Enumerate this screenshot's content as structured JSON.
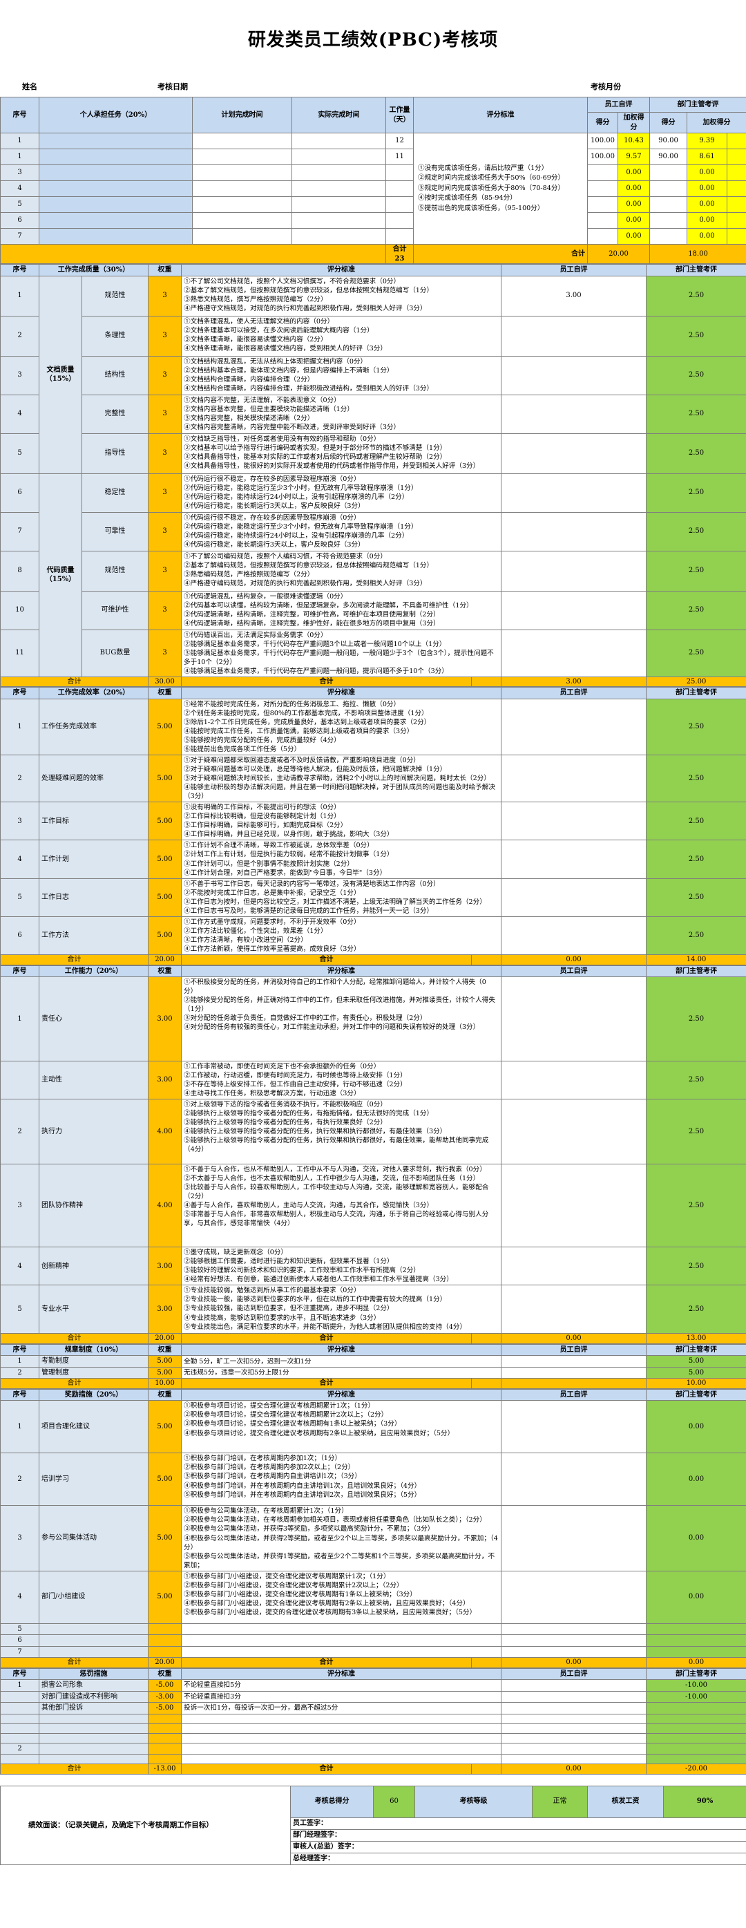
{
  "title": "研发类员工绩效(PBC)考核项",
  "info": {
    "name": "姓名",
    "date": "考核日期",
    "month": "考核月份"
  },
  "tasks": {
    "h": {
      "no": "序号",
      "task": "个人承担任务（20%）",
      "plan": "计划完成时间",
      "actual": "实际完成时间",
      "days": "工作量（天）",
      "std": "评分标准",
      "self": "员工自评",
      "mgr": "部门主管考评",
      "score": "得分",
      "wscore": "加权得分"
    },
    "std": "①没有完成该项任务，请后比较严重（1分）\n②规定时间内完成该项任务大于50%（60-69分）\n③规定时间内完成该项任务大于80%（70-84分）\n④按时完成该项任务（85-94分）\n⑤提前出色的完成该项任务，（95-100分）",
    "rows": [
      {
        "no": "1",
        "days": "12",
        "ss": "100.00",
        "sw": "10.43",
        "ms": "90.00",
        "mw": "9.39"
      },
      {
        "no": "1",
        "days": "11",
        "ss": "100.00",
        "sw": "9.57",
        "ms": "90.00",
        "mw": "8.61"
      },
      {
        "no": "3",
        "days": "",
        "ss": "",
        "sw": "0.00",
        "ms": "",
        "mw": "0.00"
      },
      {
        "no": "4",
        "days": "",
        "ss": "",
        "sw": "0.00",
        "ms": "",
        "mw": "0.00"
      },
      {
        "no": "5",
        "days": "",
        "ss": "",
        "sw": "0.00",
        "ms": "",
        "mw": "0.00"
      },
      {
        "no": "6",
        "days": "",
        "ss": "",
        "sw": "0.00",
        "ms": "",
        "mw": "0.00"
      },
      {
        "no": "7",
        "days": "",
        "ss": "",
        "sw": "0.00",
        "ms": "",
        "mw": "0.00"
      }
    ],
    "sum": {
      "label": "合计",
      "days": "23",
      "label2": "合计",
      "self": "20.00",
      "mgr": "18.00"
    }
  },
  "quality": {
    "h": {
      "no": "序号",
      "title": "工作完成质量（30%）",
      "w": "权重",
      "std": "评分标准",
      "self": "员工自评",
      "mgr": "部门主管考评"
    },
    "groups": {
      "doc": "文档质量（15%）",
      "code": "代码质量（15%）"
    },
    "rows": [
      {
        "no": "1",
        "item": "规范性",
        "w": "3",
        "self": "3.00",
        "mgr": "2.50",
        "std": "①不了解公司文档规范，按照个人文档习惯撰写，不符合规范要求（0分）\n②基本了解文档规范，但按照规范撰写的意识较淡，但总体按照文档规范编写（1分）\n③熟悉文档规范，撰写严格按照规范编写（2分）\n④严格遵守文档规范，对规范的执行和完善起到积极作用，受到相关人好评（3分）"
      },
      {
        "no": "2",
        "item": "条理性",
        "w": "3",
        "self": "",
        "mgr": "2.50",
        "std": "①文档条理混乱，使人无法理解文档的内容（0分）\n②文档条理基本可以接受，在多次阅读后能理解大概内容（1分）\n③文档条理清晰，能很容易读懂文档内容（2分）\n④文档条理清晰，能很容易读懂文档内容，受到相关人的好评（3分）"
      },
      {
        "no": "3",
        "item": "结构性",
        "w": "3",
        "self": "",
        "mgr": "2.50",
        "std": "①文档结构混乱混乱，无法从结构上体现把握文档内容（0分）\n②文档结构基本合理，能体现文档内容，但是内容编排上不清晰（1分）\n③文档结构合理清晰，内容编排合理（2分）\n④文档结构合理清晰，内容编排合理，并能积极改进结构，受到相关人的好评（3分）"
      },
      {
        "no": "4",
        "item": "完整性",
        "w": "3",
        "self": "",
        "mgr": "2.50",
        "std": "①文档内容不完整，无法理解，不能表现意义（0分）\n②文档内容基本完整，但是主要模块功能描述清晰（1分）\n③文档内容完整，相关模块描述清晰（2分）\n④文档内容完整清晰，内容完整中能不断改进，受到评审受到好评（3分）"
      },
      {
        "no": "5",
        "item": "指导性",
        "w": "3",
        "self": "",
        "mgr": "2.50",
        "std": "①文档缺乏指导性，对任务或者使用没有有效的指导和帮助（0分）\n②文档基本可以给予指导行进行编码或者实现，但是对于部分环节的描述不够清楚（1分）\n③文档具备指导性，能基本对实际的工作或者对后续的代码或者理解产生较好帮助（2分）\n④文档具备指导性，能很好的对实际开发或者使用的代码或者作指导作用，并受到相关人好评（3分）"
      },
      {
        "no": "6",
        "item": "稳定性",
        "w": "3",
        "self": "",
        "mgr": "2.50",
        "std": "①代码运行很不稳定，存在较多的因素导致程序崩溃（0分）\n②代码运行稳定，能稳定运行至少3个小时，但无故有几率导致程序崩溃（1分）\n③代码运行稳定，能持续运行24小时以上，没有引起程序崩溃的几率（2分）\n④代码运行稳定，能长期运行3天以上，客户反映良好（3分）"
      },
      {
        "no": "7",
        "item": "可靠性",
        "w": "3",
        "self": "",
        "mgr": "2.50",
        "std": "①代码运行很不稳定，存在较多的因素导致程序崩溃（0分）\n②代码运行稳定，能稳定运行至少3个小时，但无故有几率导致程序崩溃（1分）\n③代码运行稳定，能持续运行24小时以上，没有引起程序崩溃的几率（2分）\n④代码运行稳定，能长期运行3天以上，客户反映良好（3分）"
      },
      {
        "no": "8",
        "item": "规范性",
        "w": "3",
        "self": "",
        "mgr": "2.50",
        "std": "①不了解公司编码规范，按照个人编码习惯，不符合规范要求（0分）\n②基本了解编码规范，但按照规范撰写的意识较淡，但总体按照编码规范编写（1分）\n③熟悉编码规范，严格按照规范编写（2分）\n④严格遵守编码规范，对规范的执行和完善起到积极作用，受到相关人好评（3分）"
      },
      {
        "no": "10",
        "item": "可维护性",
        "w": "3",
        "self": "",
        "mgr": "2.50",
        "std": "①代码逻辑混乱，结构复杂，一般很难读懂逻辑（0分）\n②代码基本可以读懂，结构较为清晰，但是逻辑复杂，多次阅读才能理解，不具备可维护性（1分）\n③代码逻辑清晰，结构清晰，注释完整，可维护性高，可维护在本项目使用复制（2分）\n④代码逻辑清晰，结构清晰，注释完整，维护性好，能在很多地方的项目中复用（3分）"
      },
      {
        "no": "11",
        "item": "BUG数量",
        "w": "3",
        "self": "",
        "mgr": "2.50",
        "std": "①代码错误百出，无法满足实际业务需求（0分）\n②能够满足基本业务需求，千行代码存在严重问题3个以上或者一般问题10个以上（1分）\n③能够满足基本业务需求，千行代码存在严重问题一般问题，一般问题少于3个（包含3个），提示性问题不多于10个（2分）\n④能够满足基本业务需求，千行代码存在严重问题一般问题，提示问题不多于10个（3分）"
      }
    ],
    "sum": {
      "label": "合计",
      "w": "30.00",
      "label2": "合计",
      "self": "3.00",
      "mgr": "25.00"
    }
  },
  "eff": {
    "h": {
      "no": "序号",
      "title": "工作完成效率（20%）",
      "w": "权重",
      "std": "评分标准",
      "self": "员工自评",
      "mgr": "部门主管考评"
    },
    "rows": [
      {
        "no": "1",
        "item": "工作任务完成效率",
        "w": "5.00",
        "self": "",
        "mgr": "2.50",
        "std": "①经常不能按时完成任务，对所分配的任务消极怠工、拖拉、懒散（0分）\n②个别任务未能按时完成，但80%的工作都基本完成，不影响项目整体进度（1分）\n③除后1-2个工作日完成任务，完成质量良好，基本达到上级或者项目的要求（2分）\n④能按时完成工作任务，工作质量饱满，能够达到上级或者项目的要求（3分）\n⑤能够按时的完成分配的任务，完成质量较好（4分）\n⑥能提前出色完成各项工作任务（5分）"
      },
      {
        "no": "2",
        "item": "处理疑难问题的效率",
        "w": "5.00",
        "self": "",
        "mgr": "2.50",
        "std": "①对于疑难问题都采取回避态度或者不及时反馈请教，严重影响项目进度（0分）\n②对于疑难问题基本可以处理，总是等待他人解决，但能及时反馈，把问题解决掉（1分）\n③对于疑难问题解决时间较长，主动请教寻求帮助，消耗2个小时以上的时间解决问题，耗时太长（2分）\n④能够主动积极的想办法解决问题，并且在第一时间把问题解决掉，对于团队成员的问题也能及时给予解决（3分）"
      },
      {
        "no": "3",
        "item": "工作目标",
        "w": "5.00",
        "self": "",
        "mgr": "2.50",
        "std": "①没有明确的工作目标，不能提出可行的想法（0分）\n②工作目标比较明确，但是没有能够制定计划（1分）\n③工作目标明确，目标能够可行，如期完成目标（2分）\n④工作目标明确，并且已经兑现，以身作则，敢于挑战，影响大（3分）"
      },
      {
        "no": "4",
        "item": "工作计划",
        "w": "5.00",
        "self": "",
        "mgr": "2.50",
        "std": "①工作计划不合理不清晰，导致工作被延误，总体效率差（0分）\n②计划工作上有计划，但是执行能力较弱，经常不能按计划做事（1分）\n③工作计划可以，但是个别事情不能按照计划实施（2分）\n④工作计划合理，对自己严格要求，能做到\"今日事，今日毕\"（3分）"
      },
      {
        "no": "5",
        "item": "工作日志",
        "w": "5.00",
        "self": "",
        "mgr": "2.50",
        "std": "①不善于书写工作日志，每天记录的内容写一笔带过，没有清楚地表达工作内容（0分）\n②不能按时完成工作日志，总是集中补报，记录空乏（1分）\n③工作日志为按时，但是内容比较空乏，对工作描述不清楚，上级无法明确了解当天的工作任务（2分）\n④工作日志书写及时，能够清楚的记录每日完成的工作任务，并能列一天一记（3分）"
      },
      {
        "no": "6",
        "item": "工作方法",
        "w": "5.00",
        "self": "",
        "mgr": "2.50",
        "std": "①工作方式墨守成规，问题要求时，不利于开发效率（0分）\n②工作方法比较僵化，个性突出，效果差（1分）\n③工作方法清晰，有较小改进空间（2分）\n④工作方法新颖，使得工作效率显著提高，成效良好（3分）"
      }
    ],
    "sum": {
      "label": "合计",
      "w": "20.00",
      "label2": "合计",
      "self": "0.00",
      "mgr": "14.00"
    }
  },
  "ability": {
    "h": {
      "no": "序号",
      "title": "工作能力（20%）",
      "w": "权重",
      "std": "评分标准",
      "self": "员工自评",
      "mgr": "部门主管考评"
    },
    "rows": [
      {
        "no": "1",
        "item": "责任心",
        "w": "3.00",
        "self": "",
        "mgr": "2.50",
        "std": "①不积极接受分配的任务，并消极对待自己的工作和个人分配，经常推卸问题给人，并计较个人得失（0分）\n②能够接受分配的任务，并正确对待工作中的工作，但未采取任何改进措施，并对推诿责任，计较个人得失（1分）\n③对分配的任务敢于负责任，自觉做好工作中的工作，有责任心，积极处理（2分）\n④对分配的任务有较强的责任心，对工作能主动承担，并对工作中的问题和失误有较好的处理（3分）"
      },
      {
        "no": "",
        "item": "主动性",
        "w": "3.00",
        "self": "",
        "mgr": "2.50",
        "std": "①工作非常被动，即使在时间充足下也不会承担额外的任务（0分）\n②工作被动，行动迟缓，即便有时间充足力，有时候也等待上级安排（1分）\n③不存在等待上级安排工作，但工作由自己主动安排，行动不够迅速（2分）\n④主动寻找工作任务，积极思考解决方案，行动迅速（3分）"
      },
      {
        "no": "2",
        "item": "执行力",
        "w": "4.00",
        "self": "",
        "mgr": "2.50",
        "std": "①对上级领导下达的指令或者任务消极不执行，不能积极响应（0分）\n②能够执行上级领导的指令或者分配的任务，有拖拖情绪，但无法很好的完成（1分）\n③能够执行上级领导的指令或者分配的任务，有执行效果良好（2分）\n④能够执行上级领导的指令或者分配的任务，执行效果和执行都很好，有最佳效果（3分）\n⑤能够执行上级领导的指令或者分配的任务，执行效果和执行都很好，有最佳效果，能帮助其他同事完成（4分）"
      },
      {
        "no": "3",
        "item": "团队协作精神",
        "w": "4.00",
        "self": "",
        "mgr": "2.50",
        "std": "①不善于与人合作，也从不帮助别人，工作中从不与人沟通，交流，对他人要求苛刻，我行我素（0分）\n②不太善于与人合作，也不太喜欢帮助别人，工作中很少与人沟通，交流，但不影响团队任务（1分）\n③比较善于与人合作，较喜欢帮助别人，工作中较主动与人沟通，交流，能够理解和宽容别人，能够配合（2分）\n④善于与人合作，喜欢帮助别人，主动与人交流，沟通，与其合作，感觉愉快（3分）\n⑤非常善于与人合作，非常喜欢帮助别人，积极主动与人交流，沟通，乐于将自己的经验或心得与别人分享，与其合作，感觉非常愉快（4分）"
      },
      {
        "no": "4",
        "item": "创新精神",
        "w": "3.00",
        "self": "",
        "mgr": "2.50",
        "std": "①墨守成规，缺乏更新观念（0分）\n②能够根据工作需要，适时进行能力和知识更新，但效果不显著（1分）\n③能较好的理解公司新技术和知识的要求，工作效率和工作水平有所提高（2分）\n④经常有好想法、有创意，能通过创新使本人或者他人工作效率和工作水平显著提高（3分）"
      },
      {
        "no": "5",
        "item": "专业水平",
        "w": "3.00",
        "self": "",
        "mgr": "2.50",
        "std": "①专业技能较弱，勉强达到所从事工作的最基本要求（0分）\n②专业技能一般，能够达到职位要求的水平，但在以后的工作中需要有较大的提高（1分）\n③专业技能较强，能达到职位要求，但不注重提高，进步不明显（2分）\n④专业技能高，能够达到职位要求的水平，且不断追求进步（3分）\n⑤专业技能出色，满足职位要求的水平，并能不断提升，为他人或者团队提供相应的支持（4分）"
      }
    ],
    "sum": {
      "label": "合计",
      "w": "20.00",
      "label2": "合计",
      "self": "0.00",
      "mgr": "13.00"
    }
  },
  "rules": {
    "h": {
      "no": "序号",
      "title": "规章制度（10%）",
      "w": "权重",
      "std": "评分标准",
      "self": "员工自评",
      "mgr": "部门主管考评"
    },
    "rows": [
      {
        "no": "1",
        "item": "考勤制度",
        "w": "5.00",
        "std": "全勤 5分，旷工一次扣5分，迟到一次扣1分",
        "self": "",
        "mgr": "5.00"
      },
      {
        "no": "2",
        "item": "管理制度",
        "w": "5.00",
        "std": "无违规5分，违章一次扣5分上限1分",
        "self": "",
        "mgr": "5.00"
      }
    ],
    "sum": {
      "label": "合计",
      "w": "10.00",
      "label2": "合计",
      "self": "",
      "mgr": "10.00"
    }
  },
  "bonus": {
    "h": {
      "no": "序号",
      "title": "奖励措施（20%）",
      "w": "权重",
      "std": "评分标准",
      "self": "员工自评",
      "mgr": "部门主管考评"
    },
    "rows": [
      {
        "no": "1",
        "item": "项目合理化建议",
        "w": "5.00",
        "self": "",
        "mgr": "0.00",
        "std": "①积极参与项目讨论，提交合理化建议考核周期累计1次；（1分）\n②积极参与项目讨论，提交合理化建议考核周期累计2次以上；（2分）\n③积极参与项目讨论，提交合理化建议考核周期有1条以上被采纳；（3分）\n④积极参与项目讨论，提交合理化建议考核周期有2条以上被采纳，且应用效果良好；（5分）"
      },
      {
        "no": "2",
        "item": "培训学习",
        "w": "5.00",
        "self": "",
        "mgr": "0.00",
        "std": "①积极参与部门培训，在考核周期内参加1次；（1分）\n②积极参与部门培训，在考核周期内参加2次以上；（2分）\n③积极参与部门培训，在考核周期内自主讲培训1次；（3分）\n④积极参与部门培训，并在考核周期内自主讲培训1次，且培训效果良好；（4分）\n⑤积极参与部门培训，并在考核周期内自主讲培训2次，且培训效果良好；（5分）"
      },
      {
        "no": "3",
        "item": "参与公司集体活动",
        "w": "5.00",
        "self": "",
        "mgr": "0.00",
        "std": "①积极参与公司集体活动，在考核周期累计1次；（1分）\n②积极参与公司集体活动，在考核周期参加相关项目，表现或者担任重要角色（比如队长之类）；（2分）\n③积极参与公司集体活动，并获得3等奖励，多项奖以最高奖励计分，不累加；（3分）\n④积极参与公司集体活动，并获得2等奖励，或者至少2个以上三等奖，多项奖以最高奖励计分，不累加；（4分）\n⑤积极参与公司集体活动，并获得1等奖励，或者至少2个二等奖和1个三等奖，多项奖以最高奖励计分，不累加；"
      },
      {
        "no": "4",
        "item": "部门/小组建设",
        "w": "5.00",
        "self": "",
        "mgr": "0.00",
        "std": "①积极参与部门/小组建设，提交合理化建议考核周期累计1次；（1分）\n②积极参与部门/小组建设，提交合理化建议考核周期累计2次以上；（2分）\n③积极参与部门/小组建设，提交合理化建议考核周期有1条以上被采纳；（3分）\n④积极参与部门/小组建设，提交合理化建议考核周期有2条以上被采纳，且应用效果良好；（4分）\n⑤积极参与部门/小组建设，提交的合理化建议考核周期有3条以上被采纳，且应用效果良好；（5分）"
      },
      {
        "no": "5",
        "item": "",
        "w": "",
        "self": "",
        "mgr": "",
        "std": ""
      },
      {
        "no": "6",
        "item": "",
        "w": "",
        "self": "",
        "mgr": "",
        "std": ""
      },
      {
        "no": "7",
        "item": "",
        "w": "",
        "self": "",
        "mgr": "",
        "std": ""
      }
    ],
    "sum": {
      "label": "合计",
      "w": "20.00",
      "label2": "合计",
      "self": "0.00",
      "mgr": "0.00"
    }
  },
  "penalty": {
    "h": {
      "no": "序号",
      "title": "惩罚措施",
      "w": "权重",
      "std": "评分标准",
      "self": "员工自评",
      "mgr": "部门主管考评"
    },
    "rows": [
      {
        "no": "1",
        "item": "损害公司形象",
        "w": "-5.00",
        "std": "不论轻重直接扣5分",
        "self": "",
        "mgr": "-10.00"
      },
      {
        "no": "",
        "item": "对部门建设造成不利影响",
        "w": "-3.00",
        "std": "不论轻重直接扣3分",
        "self": "",
        "mgr": "-10.00"
      },
      {
        "no": "",
        "item": "其他部门投诉",
        "w": "-5.00",
        "std": "投诉一次扣1分，每投诉一次扣一分，最高不超过5分",
        "self": "",
        "mgr": ""
      },
      {
        "no": "",
        "item": "",
        "w": "",
        "std": "",
        "self": "",
        "mgr": ""
      },
      {
        "no": "",
        "item": "",
        "w": "",
        "std": "",
        "self": "",
        "mgr": ""
      },
      {
        "no": "",
        "item": "",
        "w": "",
        "std": "",
        "self": "",
        "mgr": ""
      },
      {
        "no": "2",
        "item": "",
        "w": "",
        "std": "",
        "self": "",
        "mgr": ""
      },
      {
        "no": "",
        "item": "",
        "w": "",
        "std": "",
        "self": "",
        "mgr": ""
      }
    ],
    "sum": {
      "label": "合计",
      "w": "-13.00",
      "label2": "合计",
      "self": "0.00",
      "mgr": "-20.00"
    }
  },
  "footer": {
    "interview": "绩效面谈：（记录关键点，及确定下个考核周期工作目标）",
    "total_label": "考核总得分",
    "total": "60",
    "grade_label": "考核等级",
    "grade": "正常",
    "pay_label": "核发工资",
    "pay": "90%",
    "sigs": [
      "员工签字：",
      "部门经理签字：",
      "审核人(总监）签字：",
      "总经理签字："
    ]
  }
}
